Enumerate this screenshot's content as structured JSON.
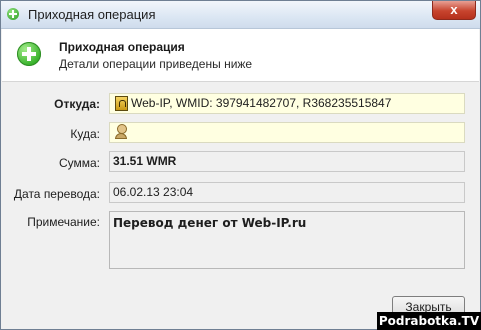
{
  "window": {
    "title": "Приходная операция",
    "close_label": "x"
  },
  "header": {
    "title": "Приходная операция",
    "subtitle": "Детали операции приведены ниже"
  },
  "form": {
    "from": {
      "label": "Откуда:",
      "value": "Web-IP, WMID: 397941482707, R368235515847"
    },
    "to": {
      "label": "Куда:",
      "value": ""
    },
    "amount": {
      "label": "Сумма:",
      "value": "31.51 WMR"
    },
    "date": {
      "label": "Дата перевода:",
      "value": "06.02.13 23:04"
    },
    "note": {
      "label": "Примечание:",
      "value": "Перевод денег от Web-IP.ru"
    }
  },
  "buttons": {
    "close": "Закрыть"
  },
  "watermark": "Podrabotka.TV"
}
